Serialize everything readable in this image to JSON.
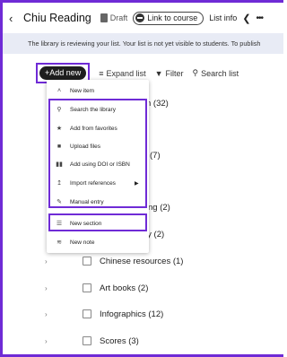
{
  "header": {
    "title": "Chiu Reading",
    "draft_label": "Draft",
    "link_label": "Link to course",
    "list_info_label": "List info"
  },
  "banner": {
    "text": "The library is reviewing your list. Your list is not yet visible to students. To publish"
  },
  "toolbar": {
    "add_new_label": "+Add new",
    "expand_label": "Expand list",
    "filter_label": "Filter",
    "search_label": "Search list"
  },
  "menu": {
    "new_item": "New item",
    "search_library": "Search the library",
    "favorites": "Add from favorites",
    "upload": "Upload files",
    "doi": "Add using DOI or ISBN",
    "import": "Import references",
    "manual": "Manual entry",
    "new_section": "New section",
    "new_note": "New note"
  },
  "partial_rows": [
    {
      "text": "n  (32)"
    },
    {
      "text": "(7)"
    },
    {
      "text": "ng  (2)"
    },
    {
      "text": "ry  (2)"
    }
  ],
  "sections": [
    {
      "label": "Chinese resources  (1)"
    },
    {
      "label": "Art books  (2)"
    },
    {
      "label": "Infographics  (12)"
    },
    {
      "label": "Scores  (3)"
    }
  ],
  "colors": {
    "highlight": "#6f2bd6",
    "banner_bg": "#e8ebf5",
    "add_new_bg": "#1e1e1e"
  }
}
